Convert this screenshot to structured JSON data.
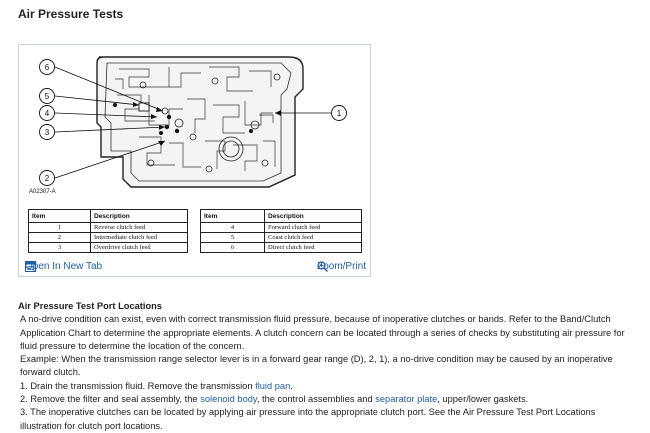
{
  "heading": "Air Pressure Tests",
  "figure": {
    "diagram_code": "A02307-A",
    "callouts": [
      "6",
      "5",
      "4",
      "3",
      "2",
      "1"
    ],
    "table_headers": {
      "item": "Item",
      "description": "Description"
    },
    "left_rows": [
      {
        "item": "1",
        "description": "Reverse clutch feed"
      },
      {
        "item": "2",
        "description": "Intermediate clutch feed"
      },
      {
        "item": "3",
        "description": "Overdrive clutch feed"
      }
    ],
    "right_rows": [
      {
        "item": "4",
        "description": "Forward clutch feed"
      },
      {
        "item": "5",
        "description": "Coast clutch feed"
      },
      {
        "item": "6",
        "description": "Direct clutch feed"
      }
    ],
    "open_label": "Open In New Tab",
    "zoom_label": "Zoom/Print"
  },
  "article": {
    "subheading": "Air Pressure Test Port Locations",
    "para1": "A no-drive condition can exist, even with correct transmission fluid pressure, because of inoperative clutches or bands. Refer to the Band/Clutch Application Chart to determine the appropriate elements. A clutch concern can be located through a series of checks by substituting air pressure for fluid pressure to determine the location of the concern.",
    "para2": "Example: When the transmission range selector lever is in a forward gear range (D), 2, 1), a no-drive condition may be caused by an inoperative forward clutch.",
    "step1_a": "1. Drain the transmission fluid. Remove the transmission ",
    "step1_link": "fluid pan",
    "step1_b": ".",
    "step2_a": "2. Remove the filter and seal assembly, the ",
    "step2_link1": "solenoid body",
    "step2_b": ", the control assemblies and ",
    "step2_link2": "separator plate",
    "step2_c": ", upper/lower gaskets.",
    "step3": "3. The inoperative clutches can be located by applying air pressure into the appropriate clutch port. See the Air Pressure Test Port Locations illustration for clutch port locations."
  }
}
